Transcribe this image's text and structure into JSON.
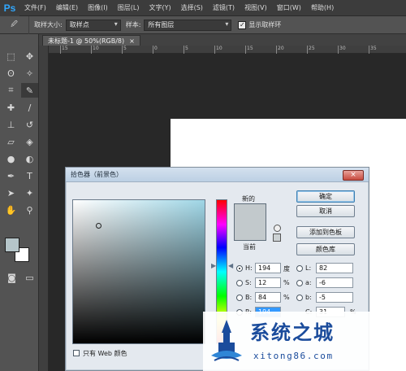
{
  "app": {
    "logo": "Ps"
  },
  "menu": [
    "文件(F)",
    "编辑(E)",
    "图像(I)",
    "图层(L)",
    "文字(Y)",
    "选择(S)",
    "滤镜(T)",
    "视图(V)",
    "窗口(W)",
    "帮助(H)"
  ],
  "options": {
    "sample_size_label": "取样大小:",
    "sample_size_value": "取样点",
    "sample_label": "样本:",
    "sample_value": "所有图层",
    "show_ring_label": "显示取样环"
  },
  "document": {
    "tab_label": "未标题-1 @ 50%(RGB/8)",
    "close": "×"
  },
  "ruler_labels": [
    "15",
    "10",
    "5",
    "0",
    "5",
    "10",
    "15",
    "20",
    "25",
    "30",
    "35"
  ],
  "swatches": {
    "foreground": "#b5c5c9",
    "background": "#ffffff"
  },
  "dialog": {
    "title": "拾色器（前景色）",
    "close": "×",
    "new_label": "新的",
    "current_label": "当前",
    "buttons": {
      "ok": "确定",
      "cancel": "取消",
      "add_swatch": "添加到色板",
      "color_libraries": "颜色库"
    },
    "hsb": {
      "h_label": "H:",
      "h_value": "194",
      "h_unit": "度",
      "s_label": "S:",
      "s_value": "12",
      "s_unit": "%",
      "b_label": "B:",
      "b_value": "84",
      "b_unit": "%"
    },
    "lab": {
      "l_label": "L:",
      "l_value": "82",
      "a_label": "a:",
      "a_value": "-6",
      "b_label": "b:",
      "b_value": "-5"
    },
    "rgb": {
      "r_label": "R:",
      "r_value": "194"
    },
    "cmyk": {
      "c_label": "C:",
      "c_value": "31",
      "c_unit": "%"
    },
    "web_only_label": "只有 Web 颜色",
    "new_color": "#c2c9cc"
  },
  "watermark": {
    "title": "系统之城",
    "url": "xitong86.com"
  }
}
